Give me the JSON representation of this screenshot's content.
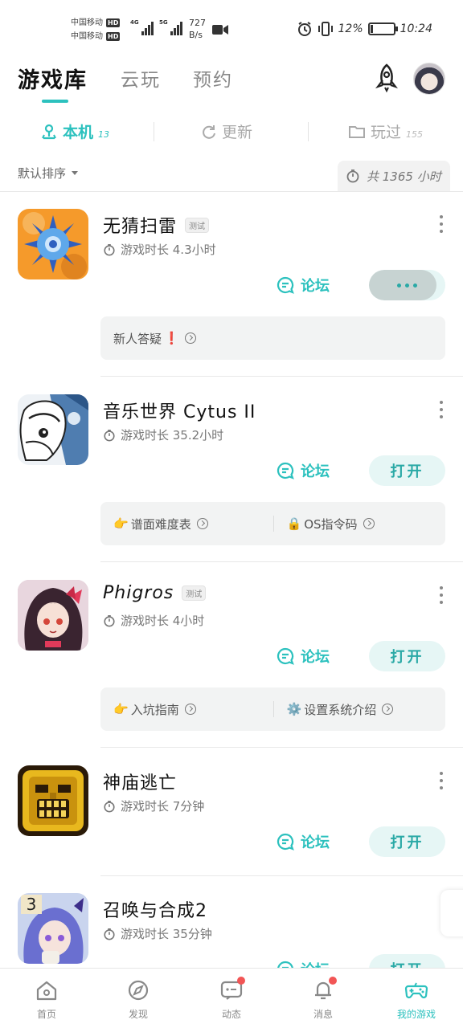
{
  "status_bar": {
    "carrier1": "中国移动",
    "carrier2": "中国移动",
    "hd": "HD",
    "net1": "4G",
    "net2": "5G",
    "speed_value": "727",
    "speed_unit": "B/s",
    "battery_text": "12%",
    "battery_level": 0.12,
    "time": "10:24"
  },
  "header": {
    "tabs": [
      {
        "label": "游戏库",
        "active": true
      },
      {
        "label": "云玩",
        "active": false
      },
      {
        "label": "预约",
        "active": false
      }
    ],
    "rocket_icon": "rocket-icon",
    "avatar_icon": "user-avatar"
  },
  "subtabs": [
    {
      "label": "本机",
      "count": "13",
      "icon": "device-icon",
      "active": true
    },
    {
      "label": "更新",
      "count": "",
      "icon": "refresh-icon",
      "active": false
    },
    {
      "label": "玩过",
      "count": "155",
      "icon": "folder-icon",
      "active": false
    }
  ],
  "sort": {
    "label": "默认排序",
    "total": "共 1365 小时"
  },
  "accent_color": "#2cc1be",
  "games": [
    {
      "title": "无猜扫雷",
      "badge": "测试",
      "playtime": "游戏时长 4.3小时",
      "forum": "论坛",
      "action": "",
      "progress": 0.88,
      "links": [
        {
          "label": "新人答疑",
          "emoji": "❗"
        }
      ]
    },
    {
      "title": "音乐世界 Cytus II",
      "badge": "",
      "playtime": "游戏时长 35.2小时",
      "forum": "论坛",
      "action": "打开",
      "links": [
        {
          "label": "谱面难度表",
          "emoji": "👉"
        },
        {
          "label": "OS指令码",
          "emoji": "🔒"
        }
      ]
    },
    {
      "title": "Phigros",
      "badge": "测试",
      "playtime": "游戏时长 4小时",
      "forum": "论坛",
      "action": "打开",
      "links": [
        {
          "label": "入坑指南",
          "emoji": "👉"
        },
        {
          "label": "设置系统介绍",
          "emoji": "⚙️"
        }
      ]
    },
    {
      "title": "神庙逃亡",
      "badge": "",
      "playtime": "游戏时长 7分钟",
      "forum": "论坛",
      "action": "打开",
      "links": []
    },
    {
      "title": "召唤与合成2",
      "badge": "",
      "playtime": "游戏时长 35分钟",
      "forum": "论坛",
      "action": "打开",
      "links": []
    }
  ],
  "bottom_nav": [
    {
      "label": "首页",
      "icon": "home-icon",
      "active": false,
      "dot": false
    },
    {
      "label": "发现",
      "icon": "discover-icon",
      "active": false,
      "dot": false
    },
    {
      "label": "动态",
      "icon": "feed-icon",
      "active": false,
      "dot": true
    },
    {
      "label": "消息",
      "icon": "bell-icon",
      "active": false,
      "dot": true
    },
    {
      "label": "我的游戏",
      "icon": "gamepad-icon",
      "active": true,
      "dot": false
    }
  ]
}
